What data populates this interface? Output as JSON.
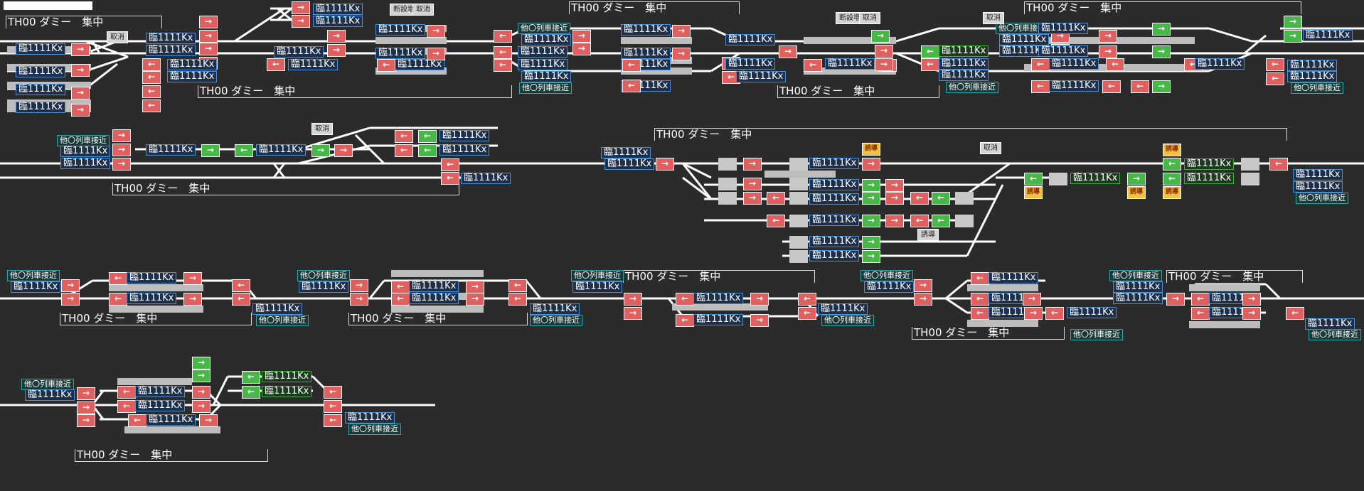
{
  "title_bar": "",
  "zone_title": "TH00 ダミー　集中",
  "train_label": "臨1111Kx",
  "approach_label": "他〇列車接近",
  "btn_cancel": "取消",
  "btn_cut": "断設増",
  "btn_route": "誘導",
  "arrow_right": "→",
  "arrow_left": "←",
  "colors": {
    "background": "#2b2b2b",
    "signal_red": "#e06060",
    "signal_green": "#47b847",
    "signal_gray": "#c8c8c8",
    "signal_amber": "#f0c040",
    "signal_pink": "#f0508a",
    "track": "#ffffff",
    "label_border": "#4a90d8",
    "approach_border": "#2aa6a6"
  }
}
